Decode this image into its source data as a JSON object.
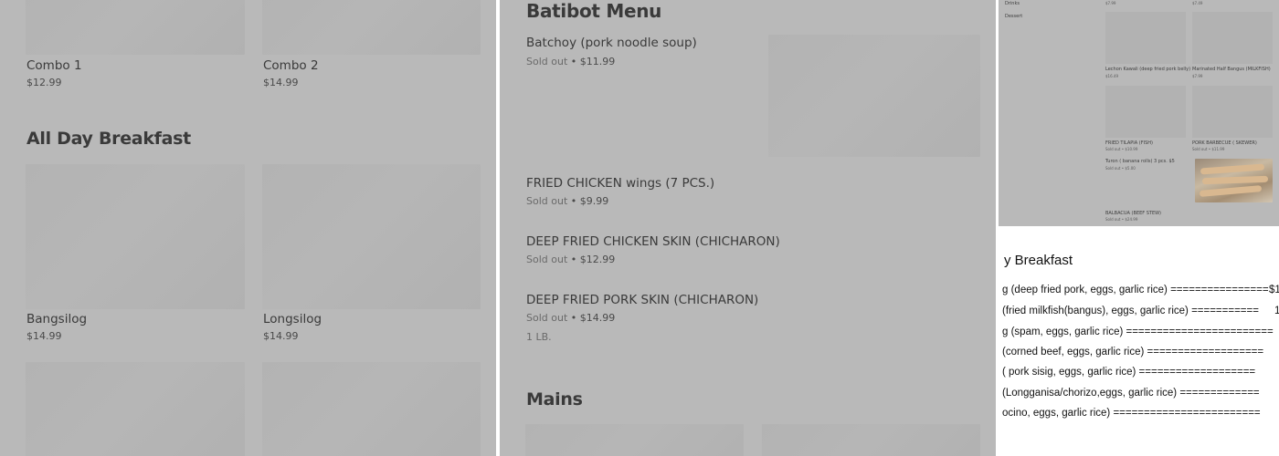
{
  "left_panel": {
    "items_top": [
      {
        "name": "Combo 1",
        "price": "$12.99"
      },
      {
        "name": "Combo 2",
        "price": "$14.99"
      }
    ],
    "section_title": "All Day Breakfast",
    "items_breakfast": [
      {
        "name": "Bangsilog",
        "price": "$14.99"
      },
      {
        "name": "Longsilog",
        "price": "$14.99"
      }
    ]
  },
  "middle_panel": {
    "menu_title": "Batibot Menu",
    "items": [
      {
        "name": "Batchoy (pork noodle soup)",
        "status": "Sold out",
        "sep": " • ",
        "price": "$11.99"
      },
      {
        "name": "FRIED CHICKEN wings (7 PCS.)",
        "status": "Sold out",
        "sep": " • ",
        "price": "$9.99"
      },
      {
        "name": "DEEP FRIED CHICKEN SKIN (CHICHARON)",
        "status": "Sold out",
        "sep": " • ",
        "price": "$12.99"
      },
      {
        "name": "DEEP FRIED PORK SKIN (CHICHARON)",
        "status": "Sold out",
        "sep": " • ",
        "price": "$14.99",
        "note": "1 LB."
      }
    ],
    "section_title": "Mains"
  },
  "right_panel": {
    "sidebar": [
      "Drinks",
      "Dessert"
    ],
    "top_prices": [
      "$7.99",
      "$7.49"
    ],
    "items": [
      {
        "name": "Lechon Kawali (deep fried pork belly)",
        "price": "$16.49"
      },
      {
        "name": "Marinated Half Bangus (MILKFISH)",
        "price": "$7.99"
      },
      {
        "name": "FRIED TILAPIA (FISH)",
        "price": "Sold out • $10.99"
      },
      {
        "name": "PORK BARBECUE ( SKEWER)",
        "price": "Sold out • $11.99"
      },
      {
        "name": "Turon ( banana rolls) 3 pcs. $5",
        "price": "Sold out • $5.00"
      },
      {
        "name": "BALBACUA (BEEF STEW)",
        "price": "Sold out • $24.99"
      }
    ],
    "document": {
      "title": "y Breakfast",
      "lines": [
        {
          "text": "g (deep fried pork, eggs, garlic rice) ================",
          "price": "$1"
        },
        {
          "text": " (fried milkfish(bangus), eggs, garlic rice) ===========",
          "price": "1"
        },
        {
          "text": "g (spam, eggs, garlic rice)  ========================"
        },
        {
          "text": " (corned beef, eggs, garlic rice)  ==================="
        },
        {
          "text": "  ( pork sisig, eggs, garlic rice)     ==================="
        },
        {
          "text": " (Longganisa/chorizo,eggs, garlic rice) ============="
        },
        {
          "text": "ocino, eggs, garlic rice)  ========================"
        }
      ]
    }
  }
}
